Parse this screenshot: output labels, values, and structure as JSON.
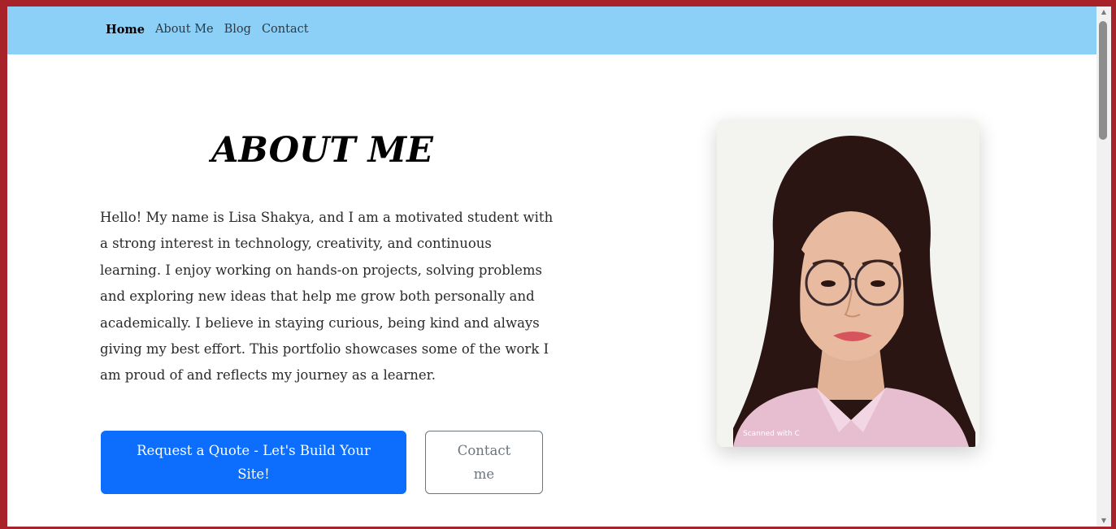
{
  "nav": {
    "links": [
      "Home",
      "About Me",
      "Blog",
      "Contact"
    ],
    "active": "Home"
  },
  "hero": {
    "title": "ABOUT ME",
    "paragraph": "Hello! My name is Lisa Shakya, and I am a motivated student with a strong interest in technology, creativity, and continuous learning. I enjoy working on hands-on projects, solving problems and exploring new ideas that help me grow both personally and academically. I believe in staying curious, being kind and always giving my best effort. This portfolio showcases some of the work I am proud of and reflects my journey as a learner.",
    "primary_button": "Request a Quote - Let's Build Your Site!",
    "secondary_button": "Contact me"
  },
  "photo": {
    "watermark": "Scanned with C"
  },
  "colors": {
    "navbar": "#8ccff7",
    "frame_border": "#a8222a",
    "primary_button": "#0d6efd",
    "secondary_button_border": "#6c757d"
  },
  "icons": {
    "scroll_up": "scroll-up-arrow-icon",
    "scroll_down": "scroll-down-arrow-icon"
  }
}
